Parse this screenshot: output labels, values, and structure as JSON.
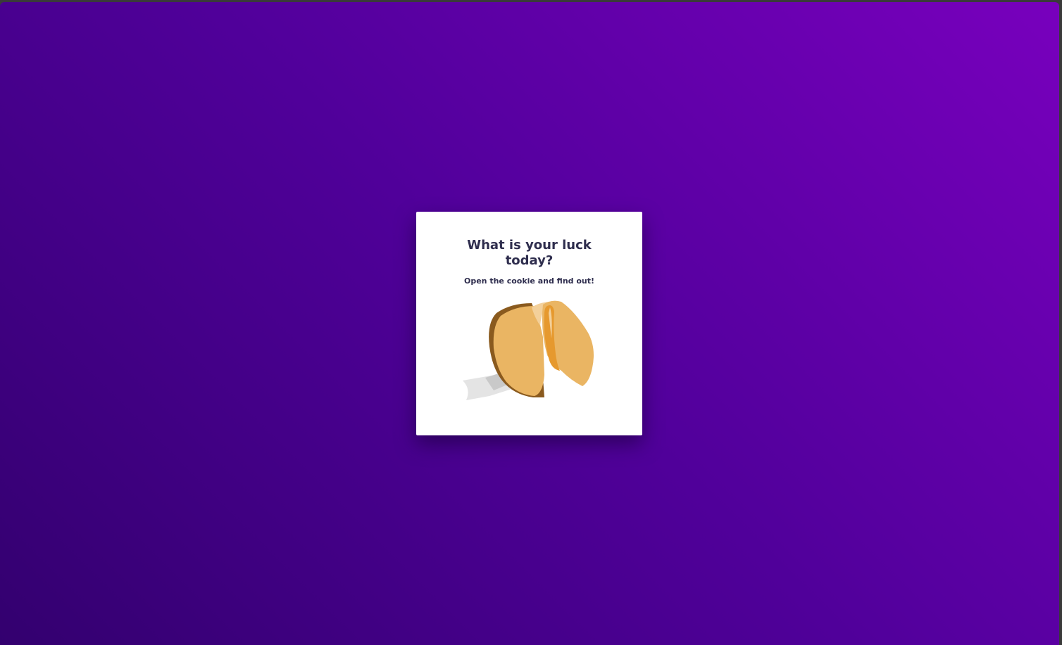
{
  "card": {
    "title": "What is your luck today?",
    "subtitle": "Open the cookie and find out!"
  },
  "cookie": {
    "icon": "fortune-cookie-icon",
    "colors": {
      "dough": "#eab563",
      "dough_dark": "#e6992e",
      "crust": "#8a5a1e",
      "paper": "#e4e4e4",
      "paper_shadow": "#c9c9c9"
    }
  },
  "colors": {
    "background_start": "#33006f",
    "background_end": "#7800bd",
    "text": "#2f2e4e",
    "card": "#ffffff"
  }
}
